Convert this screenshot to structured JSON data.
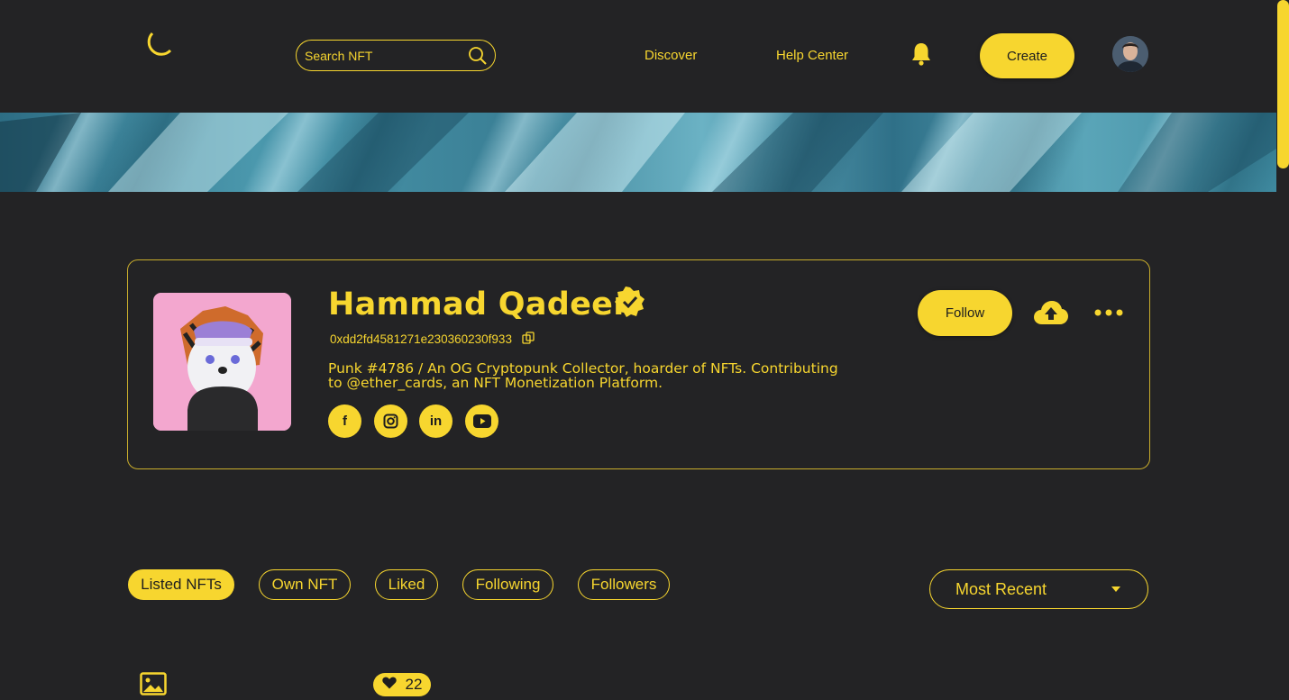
{
  "header": {
    "logo_icon": "crescent-moon-logo-icon",
    "search": {
      "placeholder": "Search NFT",
      "icon": "search-icon"
    },
    "nav": [
      {
        "label": "Discover"
      },
      {
        "label": "Help Center"
      }
    ],
    "notification_icon": "bell-icon",
    "create_label": "Create",
    "avatar_icon": "user-avatar"
  },
  "banner": {
    "description_icon": "ocean-texture-banner"
  },
  "profile": {
    "name": "Hammad Qadeer",
    "verified_icon": "verified-badge-icon",
    "wallet": "0xdd2fd4581271e230360230f933",
    "copy_icon": "copy-icon",
    "bio": "Punk #4786 / An OG Cryptopunk Collector, hoarder of NFTs. Contributing to @ether_cards, an NFT Monetization Platform.",
    "socials": [
      {
        "name": "facebook",
        "glyph": "f"
      },
      {
        "name": "instagram",
        "glyph": "◘"
      },
      {
        "name": "linkedin",
        "glyph": "in"
      },
      {
        "name": "youtube",
        "glyph": "▶"
      }
    ],
    "follow_label": "Follow",
    "upload_icon": "cloud-upload-icon",
    "more_icon": "more-dots-icon"
  },
  "tabs": {
    "items": [
      {
        "label": "Listed NFTs",
        "active": true
      },
      {
        "label": "Own NFT",
        "active": false
      },
      {
        "label": "Liked",
        "active": false
      },
      {
        "label": "Following",
        "active": false
      },
      {
        "label": "Followers",
        "active": false
      }
    ],
    "sort_selected": "Most Recent"
  },
  "listing_preview": {
    "image_icon": "image-icon",
    "likes": "22"
  },
  "colors": {
    "background": "#232325",
    "accent": "#f7d62f",
    "dark_text": "#1d1d1f"
  }
}
